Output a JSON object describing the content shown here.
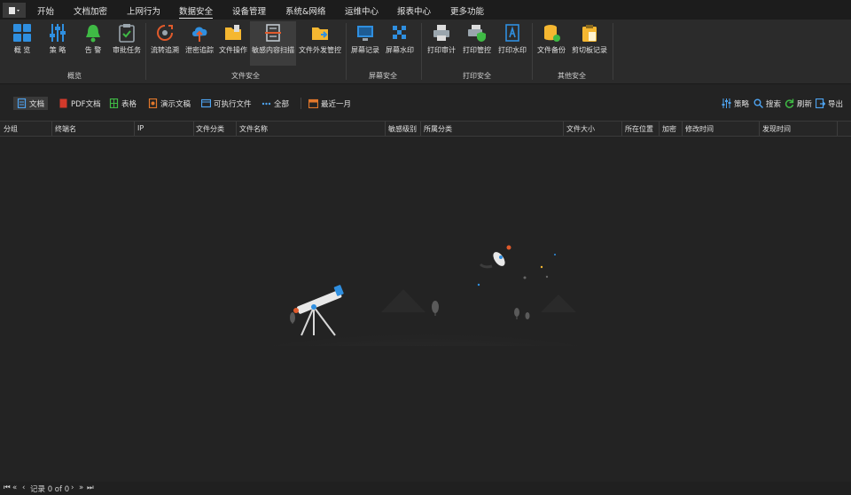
{
  "menubar": {
    "items": [
      "开始",
      "文档加密",
      "上网行为",
      "数据安全",
      "设备管理",
      "系统&网络",
      "运维中心",
      "报表中心",
      "更多功能"
    ],
    "active_index": 3
  },
  "ribbon": {
    "groups": [
      {
        "label": "概览",
        "buttons": [
          {
            "label": "概 览",
            "icon": "grid-icon"
          },
          {
            "label": "策 略",
            "icon": "sliders-icon"
          },
          {
            "label": "告 警",
            "icon": "bell-icon"
          },
          {
            "label": "审批任务",
            "icon": "clipboard-check-icon"
          }
        ]
      },
      {
        "label": "文件安全",
        "buttons": [
          {
            "label": "流转追溯",
            "icon": "trace-icon"
          },
          {
            "label": "泄密追踪",
            "icon": "cloud-upload-icon"
          },
          {
            "label": "文件操作",
            "icon": "folder-icon"
          },
          {
            "label": "敏感内容扫描",
            "icon": "scan-doc-icon",
            "selected": true
          },
          {
            "label": "文件外发管控",
            "icon": "folder-send-icon"
          }
        ]
      },
      {
        "label": "屏幕安全",
        "buttons": [
          {
            "label": "屏幕记录",
            "icon": "monitor-icon"
          },
          {
            "label": "屏幕水印",
            "icon": "watermark-icon"
          }
        ]
      },
      {
        "label": "打印安全",
        "buttons": [
          {
            "label": "打印审计",
            "icon": "printer-icon"
          },
          {
            "label": "打印管控",
            "icon": "printer-shield-icon"
          },
          {
            "label": "打印水印",
            "icon": "print-watermark-icon"
          }
        ]
      },
      {
        "label": "其他安全",
        "buttons": [
          {
            "label": "文件备份",
            "icon": "database-icon"
          },
          {
            "label": "剪切板记录",
            "icon": "clipboard-icon"
          }
        ]
      }
    ]
  },
  "toolbar": {
    "filters": [
      {
        "label": "文档",
        "icon": "document-icon",
        "selected": true
      },
      {
        "label": "PDF文档",
        "icon": "pdf-icon"
      },
      {
        "label": "表格",
        "icon": "spreadsheet-icon"
      },
      {
        "label": "演示文稿",
        "icon": "presentation-icon"
      },
      {
        "label": "可执行文件",
        "icon": "executable-icon"
      },
      {
        "label": "全部",
        "icon": "dots-icon"
      }
    ],
    "date_range": "最近一月",
    "actions": [
      {
        "label": "策略",
        "icon": "sliders-icon"
      },
      {
        "label": "搜索",
        "icon": "search-icon"
      },
      {
        "label": "刷新",
        "icon": "refresh-icon"
      },
      {
        "label": "导出",
        "icon": "export-icon"
      }
    ]
  },
  "table": {
    "columns": [
      "分组",
      "终端名",
      "IP",
      "文件分类",
      "文件名称",
      "敏感级别",
      "所属分类",
      "文件大小",
      "所在位置",
      "加密",
      "修改时间",
      "发现时间"
    ],
    "rows": []
  },
  "statusbar": {
    "record_text": "记录 0 of 0"
  },
  "colors": {
    "background": "#232323",
    "menubar": "#1c1c1c",
    "ribbon": "#2b2b2b",
    "accent_blue": "#2f8fe0",
    "accent_yellow": "#f5b731",
    "accent_green": "#3fba45"
  }
}
